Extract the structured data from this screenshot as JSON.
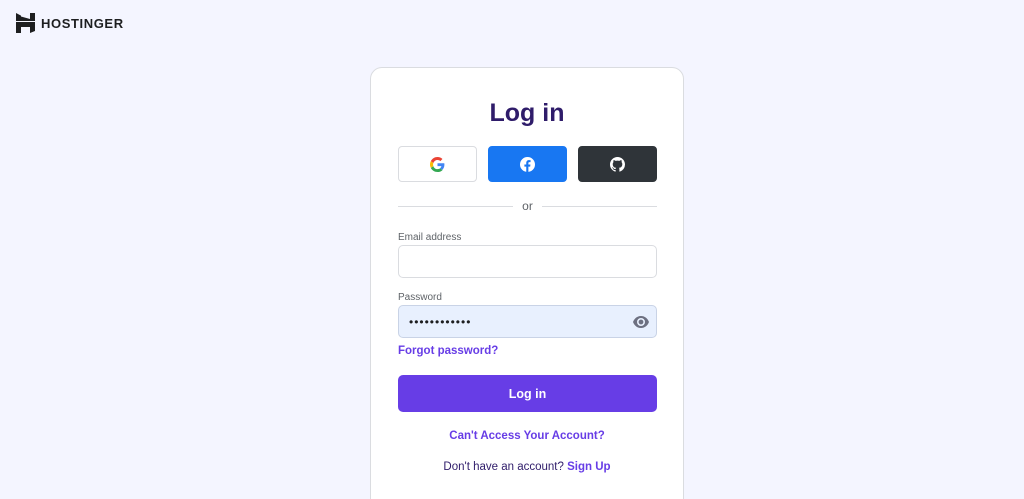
{
  "brand": {
    "name": "HOSTINGER"
  },
  "login": {
    "title": "Log in",
    "socials": [
      {
        "provider": "google",
        "icon": "google-icon"
      },
      {
        "provider": "facebook",
        "icon": "facebook-icon"
      },
      {
        "provider": "github",
        "icon": "github-icon"
      }
    ],
    "divider_text": "or",
    "email": {
      "label": "Email address",
      "value": "",
      "placeholder": ""
    },
    "password": {
      "label": "Password",
      "value": "••••••••••••",
      "icon": "eye-icon"
    },
    "forgot_label": "Forgot password?",
    "submit_label": "Log in",
    "cant_access_label": "Can't Access Your Account?",
    "signup_prompt": "Don't have an account?",
    "signup_label": "Sign Up"
  },
  "colors": {
    "accent": "#673de6",
    "title": "#2f1c6a",
    "facebook": "#1877f2",
    "github": "#2f3439",
    "background": "#f4f5ff"
  }
}
